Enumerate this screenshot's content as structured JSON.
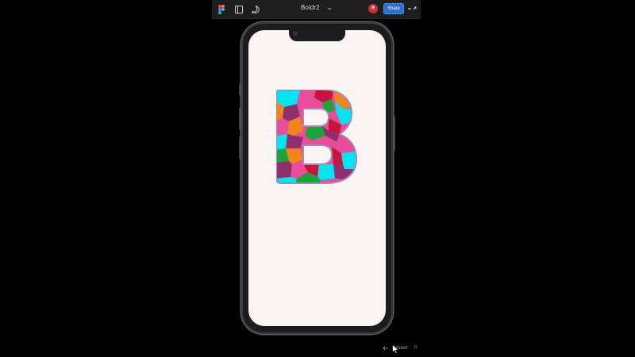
{
  "toolbar": {
    "file_title": "Boldr2",
    "share_label": "Share",
    "avatar_initial": "R",
    "icons": {
      "logo": "figma-logo-icon",
      "panel": "panel-icon",
      "comment": "comment-icon",
      "chevron": "chevron-down-icon",
      "more": "expand-icon"
    }
  },
  "canvas": {
    "letter": "B",
    "background": "#f9f4f1",
    "patch_colors": [
      "#00e5f2",
      "#e94d9a",
      "#f2841e",
      "#c8133a",
      "#1aa53a",
      "#8e2f6e"
    ]
  },
  "footer": {
    "restart_label": "Restart",
    "restart_key": "R"
  },
  "colors": {
    "share_button": "#2a6fc9",
    "avatar": "#c8312f",
    "toolbar_bg": "#1e1e1e"
  }
}
